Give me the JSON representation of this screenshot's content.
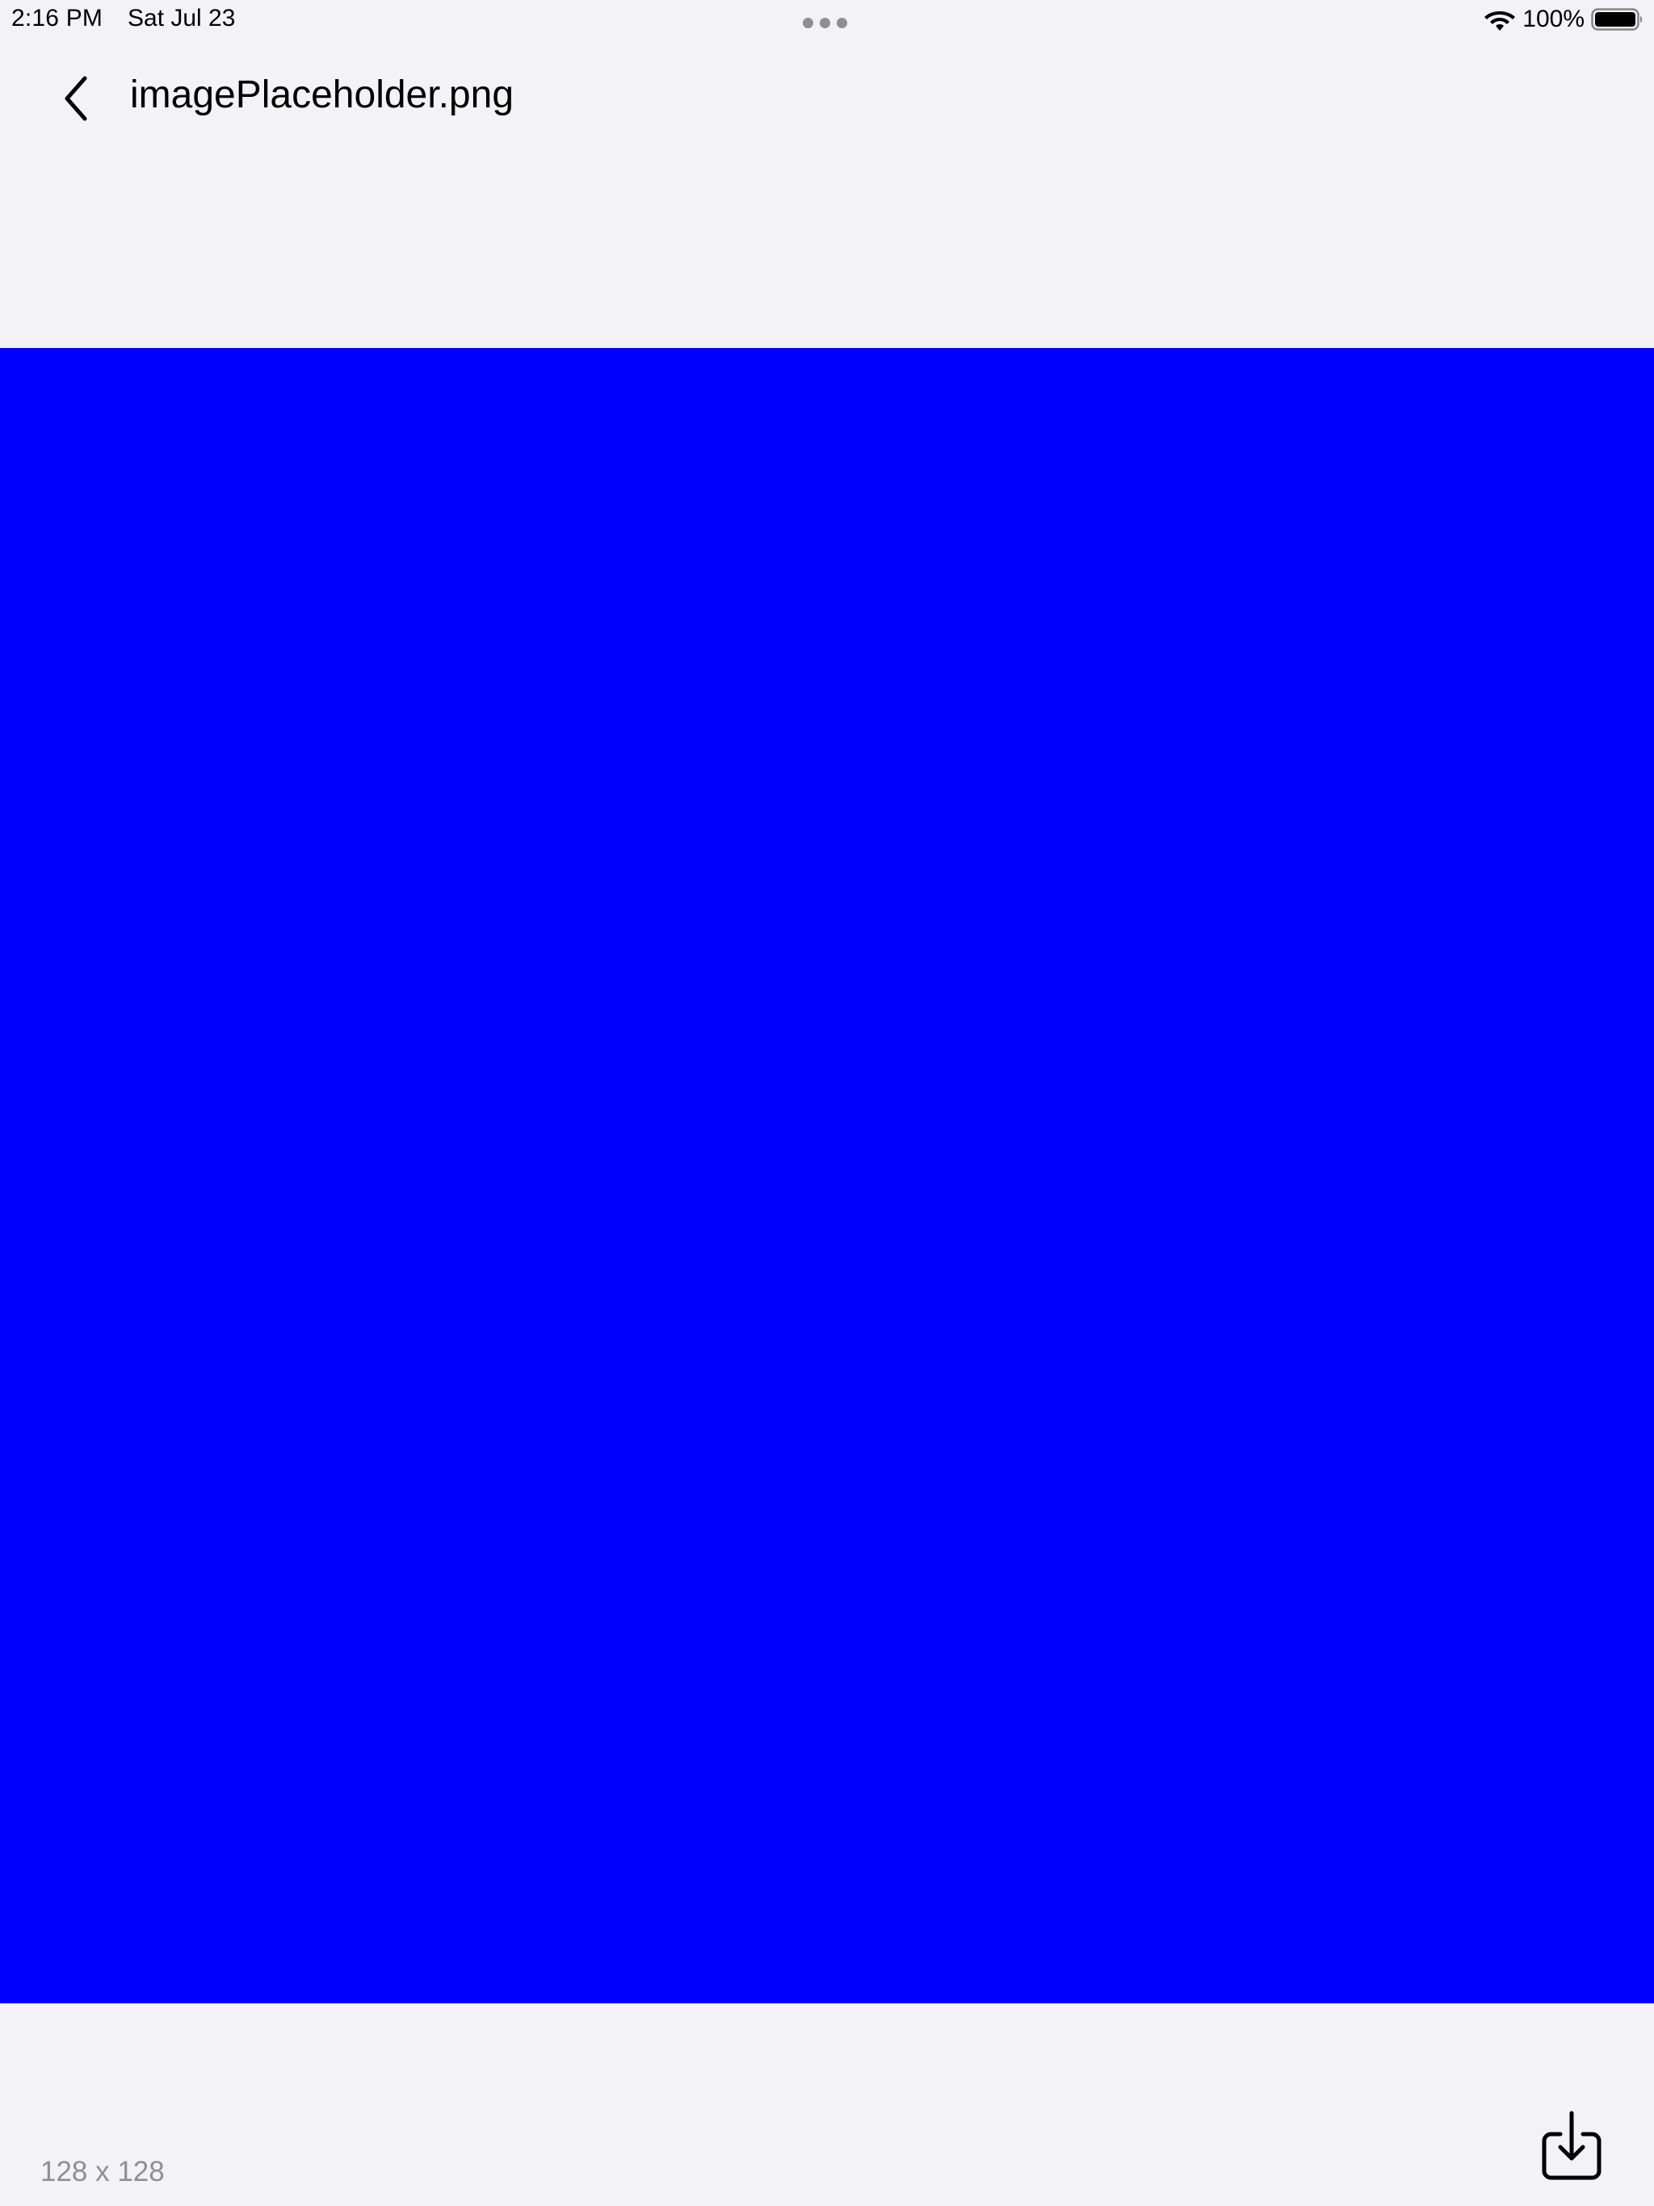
{
  "status_bar": {
    "time": "2:16 PM",
    "date": "Sat Jul 23",
    "battery_percent": "100%",
    "battery_level": 1.0,
    "wifi_icon": "wifi-icon",
    "battery_icon": "battery-icon",
    "multitask_icon": "multitask-dots-icon"
  },
  "nav": {
    "back_icon": "chevron-left-icon",
    "title": "imagePlaceholder.png"
  },
  "preview": {
    "fill_color": "#0000ff"
  },
  "footer": {
    "dimensions": "128 x 128",
    "save_icon": "save-to-device-icon"
  },
  "colors": {
    "background": "#f2f2f7",
    "secondary_text": "#8e8e93",
    "image_fill": "#0000ff"
  }
}
